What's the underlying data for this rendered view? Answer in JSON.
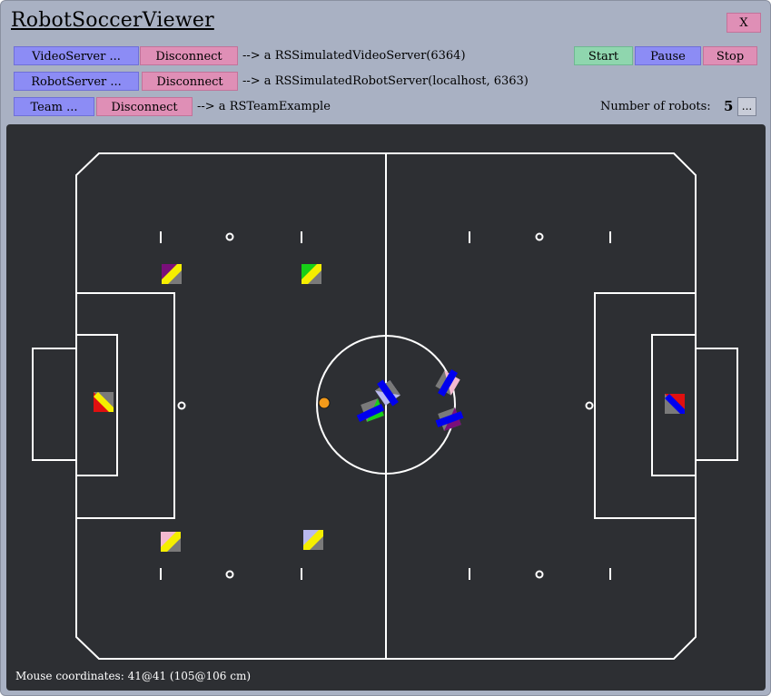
{
  "window": {
    "title": "RobotSoccerViewer",
    "close_label": "X"
  },
  "video_row": {
    "server_button": "VideoServer ...",
    "disconnect_button": "Disconnect",
    "status": "--> a RSSimulatedVideoServer(6364)"
  },
  "robot_row": {
    "server_button": "RobotServer ...",
    "disconnect_button": "Disconnect",
    "status": "--> a RSSimulatedRobotServer(localhost, 6363)"
  },
  "team_row": {
    "team_button": "Team ...",
    "disconnect_button": "Disconnect",
    "status": "--> a RSTeamExample"
  },
  "controls": {
    "start": "Start",
    "pause": "Pause",
    "stop": "Stop"
  },
  "robots": {
    "label": "Number of robots:",
    "count": "5",
    "more_button": "..."
  },
  "status_bar": {
    "mouse_coordinates": "Mouse coordinates: 41@41 (105@106 cm)"
  },
  "colors": {
    "window_bg": "#a9b1c3",
    "field_bg": "#2d2f33",
    "button_blue": "#8c8cf5",
    "button_pink": "#df8fb6",
    "button_green": "#8fd6ae",
    "ball": "#f39a1a",
    "robot_body": "#7a7a7a",
    "team_blue": "#0000ee",
    "team_yellow": "#f5ee00"
  }
}
